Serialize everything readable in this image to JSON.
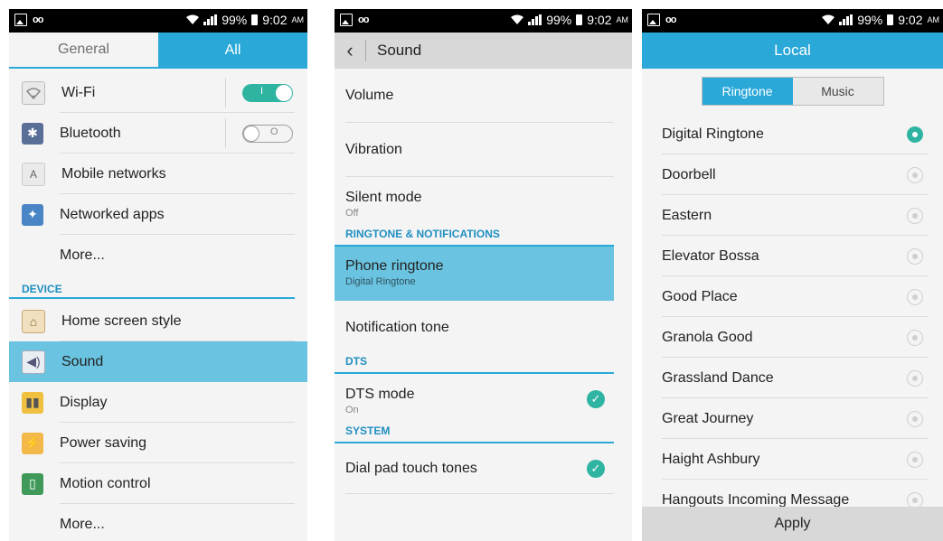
{
  "status": {
    "battery": "99%",
    "time": "9:02",
    "ampm": "AM"
  },
  "settings": {
    "tabs": [
      {
        "label": "General"
      },
      {
        "label": "All"
      }
    ],
    "wifi": {
      "label": "Wi-Fi",
      "toggle_mark": "I",
      "on": true
    },
    "bluetooth": {
      "label": "Bluetooth",
      "toggle_mark": "O",
      "on": false
    },
    "mobile_networks": {
      "label": "Mobile networks"
    },
    "networked_apps": {
      "label": "Networked apps"
    },
    "more1": {
      "label": "More..."
    },
    "device_section": "DEVICE",
    "home_screen_style": {
      "label": "Home screen style"
    },
    "sound": {
      "label": "Sound"
    },
    "display": {
      "label": "Display"
    },
    "power_saving": {
      "label": "Power saving"
    },
    "motion_control": {
      "label": "Motion control"
    },
    "more2": {
      "label": "More..."
    }
  },
  "sound": {
    "title": "Sound",
    "volume": {
      "label": "Volume"
    },
    "vibration": {
      "label": "Vibration"
    },
    "silent_mode": {
      "label": "Silent mode",
      "value": "Off"
    },
    "ringtone_section": "RINGTONE & NOTIFICATIONS",
    "phone_ringtone": {
      "label": "Phone ringtone",
      "value": "Digital Ringtone"
    },
    "notification_tone": {
      "label": "Notification tone"
    },
    "dts_section": "DTS",
    "dts_mode": {
      "label": "DTS mode",
      "value": "On",
      "checked": true
    },
    "system_section": "SYSTEM",
    "dial_pad": {
      "label": "Dial pad touch tones",
      "checked": true
    }
  },
  "local": {
    "title": "Local",
    "segments": {
      "ringtone": "Ringtone",
      "music": "Music"
    },
    "ringtones": [
      {
        "name": "Digital Ringtone",
        "selected": true
      },
      {
        "name": "Doorbell",
        "selected": false
      },
      {
        "name": "Eastern",
        "selected": false
      },
      {
        "name": "Elevator Bossa",
        "selected": false
      },
      {
        "name": "Good Place",
        "selected": false
      },
      {
        "name": "Granola Good",
        "selected": false
      },
      {
        "name": "Grassland Dance",
        "selected": false
      },
      {
        "name": "Great Journey",
        "selected": false
      },
      {
        "name": "Haight Ashbury",
        "selected": false
      },
      {
        "name": "Hangouts Incoming Message",
        "selected": false
      }
    ],
    "apply": "Apply"
  },
  "colors": {
    "accent": "#2aa8d8",
    "selected_row": "#6ac3e0",
    "toggle_on": "#2fb4a2"
  }
}
